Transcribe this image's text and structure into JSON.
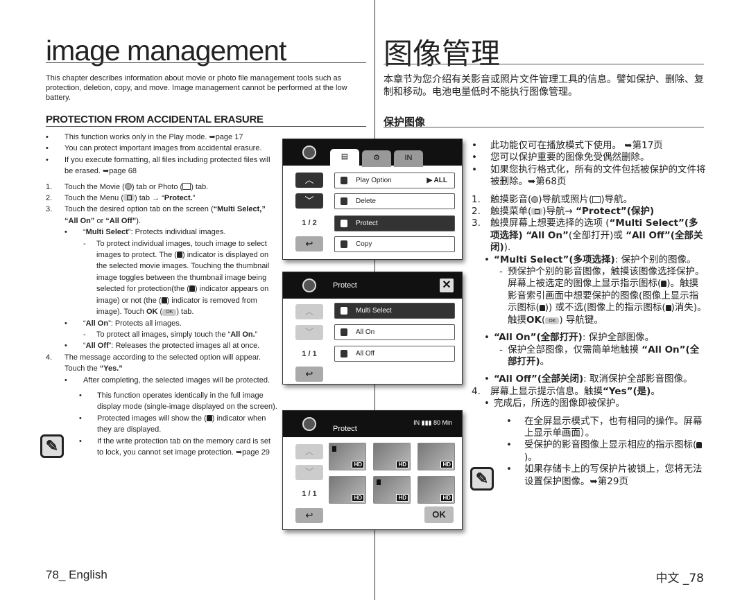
{
  "left": {
    "title": "image management",
    "intro": "This chapter describes information about movie or photo file management tools such as protection, deletion, copy, and move. Image management cannot be performed at the low battery.",
    "heading": "PROTECTION FROM ACCIDENTAL ERASURE",
    "items": [
      {
        "kind": "bullet",
        "mk": "•",
        "segs": [
          {
            "t": "This function works only in the Play mode. ➥page 17"
          }
        ]
      },
      {
        "kind": "bullet",
        "mk": "•",
        "segs": [
          {
            "t": "You can protect important images from accidental erasure."
          }
        ]
      },
      {
        "kind": "bullet",
        "mk": "•",
        "segs": [
          {
            "t": "If you execute formatting, all files including protected files will be erased. ➥page 68"
          }
        ]
      },
      {
        "kind": "num gap",
        "mk": "1.",
        "segs": [
          {
            "t": "Touch the Movie ("
          },
          {
            "icon": "movie"
          },
          {
            "t": ") tab or Photo ("
          },
          {
            "icon": "photo"
          },
          {
            "t": ") tab."
          }
        ]
      },
      {
        "kind": "num",
        "mk": "2.",
        "segs": [
          {
            "t": "Touch the Menu ("
          },
          {
            "icon": "menu"
          },
          {
            "t": ") tab → “"
          },
          {
            "t": "Protect.",
            "b": true
          },
          {
            "t": "”"
          }
        ]
      },
      {
        "kind": "num",
        "mk": "3.",
        "segs": [
          {
            "t": "Touch the desired option tab on the screen ("
          },
          {
            "t": "“Multi Select,” “All On”",
            "b": true
          },
          {
            "t": " or "
          },
          {
            "t": "“All Off”",
            "b": true
          },
          {
            "t": ")."
          }
        ]
      },
      {
        "kind": "sub",
        "mk": "•",
        "segs": [
          {
            "t": "“"
          },
          {
            "t": "Multi Select",
            "b": true
          },
          {
            "t": "”: Protects individual images."
          }
        ]
      },
      {
        "kind": "dash",
        "mk": "-",
        "segs": [
          {
            "t": "To protect individual images, touch image to select images to protect. The ("
          },
          {
            "icon": "lock"
          },
          {
            "t": ") indicator is displayed on the selected movie images. Touching the thumbnail image toggles between the thumbnail image being selected for protection(the ("
          },
          {
            "icon": "lock"
          },
          {
            "t": ") indicator appears on image) or not (the ("
          },
          {
            "icon": "lock"
          },
          {
            "t": ") indicator is removed from image). Touch "
          },
          {
            "t": "OK",
            "b": true
          },
          {
            "t": " ("
          },
          {
            "icon": "ok"
          },
          {
            "t": ") tab."
          }
        ]
      },
      {
        "kind": "sub",
        "mk": "•",
        "segs": [
          {
            "t": "“"
          },
          {
            "t": "All On",
            "b": true
          },
          {
            "t": "”: Protects all images."
          }
        ]
      },
      {
        "kind": "dash",
        "mk": "-",
        "segs": [
          {
            "t": "To protect all images, simply touch the “"
          },
          {
            "t": "All On.",
            "b": true
          },
          {
            "t": "”"
          }
        ]
      },
      {
        "kind": "sub",
        "mk": "•",
        "segs": [
          {
            "t": "“"
          },
          {
            "t": "All Off",
            "b": true
          },
          {
            "t": "”: Releases the protected images all at once."
          }
        ]
      },
      {
        "kind": "num",
        "mk": "4.",
        "segs": [
          {
            "t": "The message according to the selected option will appear. Touch the "
          },
          {
            "t": "“Yes.”",
            "b": true
          }
        ]
      },
      {
        "kind": "sub",
        "mk": "•",
        "segs": [
          {
            "t": "After completing, the selected images will be protected."
          }
        ]
      },
      {
        "kind": "note gap",
        "mk": "•",
        "segs": [
          {
            "t": "This function operates identically in the full image display mode (single-image displayed on the screen)."
          }
        ]
      },
      {
        "kind": "note",
        "mk": "•",
        "segs": [
          {
            "t": "Protected images will show the ("
          },
          {
            "icon": "lock"
          },
          {
            "t": ") indicator when they are displayed."
          }
        ]
      },
      {
        "kind": "note",
        "mk": "•",
        "segs": [
          {
            "t": "If the write protection tab on the memory card is set to lock, you cannot set image protection. ➥page 29"
          }
        ]
      }
    ],
    "footer": "78_ English"
  },
  "right": {
    "title": "图像管理",
    "intro": "本章节为您介绍有关影音或照片文件管理工具的信息。譬如保护、删除、复制和移动。电池电量低时不能执行图像管理。",
    "heading": "保护图像",
    "items": [
      {
        "kind": "bullet",
        "mk": "•",
        "segs": [
          {
            "t": "此功能仅可在播放模式下使用。 ➥第17页"
          }
        ]
      },
      {
        "kind": "bullet",
        "mk": "•",
        "segs": [
          {
            "t": "您可以保护重要的图像免受偶然删除。"
          }
        ]
      },
      {
        "kind": "bullet",
        "mk": "•",
        "segs": [
          {
            "t": "如果您执行格式化，所有的文件包括被保护的文件将被删除。➥第68页"
          }
        ]
      },
      {
        "kind": "num gap",
        "mk": "1.",
        "segs": [
          {
            "t": "触摸影音("
          },
          {
            "icon": "movie"
          },
          {
            "t": ")导航或照片("
          },
          {
            "icon": "photo"
          },
          {
            "t": ")导航。"
          }
        ]
      },
      {
        "kind": "num",
        "mk": "2.",
        "segs": [
          {
            "t": "触摸菜单("
          },
          {
            "icon": "menu"
          },
          {
            "t": ")导航→ "
          },
          {
            "t": "“Protect”(保护)",
            "b": true
          }
        ]
      },
      {
        "kind": "num",
        "mk": "3.",
        "segs": [
          {
            "t": "触摸屏幕上想要选择的选项 ("
          },
          {
            "t": "“Multi Select”(多项选择) “All On”",
            "b": true
          },
          {
            "t": "(全部打开)或 "
          },
          {
            "t": "“All Off”(全部关闭)",
            "b": true
          },
          {
            "t": ")."
          }
        ]
      },
      {
        "kind": "sub",
        "mk": "•",
        "segs": [
          {
            "t": "“Multi Select”(多项选择)",
            "b": true
          },
          {
            "t": ": 保护个别的图像。"
          }
        ]
      },
      {
        "kind": "dash",
        "mk": "-",
        "segs": [
          {
            "t": "预保护个别的影音图像，触摸该图像选择保护。屏幕上被选定的图像上显示指示图标("
          },
          {
            "icon": "lock"
          },
          {
            "t": ")。触摸影音索引画面中想要保护的图像(图像上显示指示图标("
          },
          {
            "icon": "lock"
          },
          {
            "t": ")) 或不选(图像上的指示图标("
          },
          {
            "icon": "lock"
          },
          {
            "t": ")消失)。 触摸"
          },
          {
            "t": "OK",
            "b": true
          },
          {
            "t": "("
          },
          {
            "icon": "ok"
          },
          {
            "t": ") 导航键。"
          }
        ]
      },
      {
        "kind": "sub gap",
        "mk": "•",
        "segs": [
          {
            "t": "“All On”(全部打开)",
            "b": true
          },
          {
            "t": ": 保护全部图像。"
          }
        ]
      },
      {
        "kind": "dash",
        "mk": "-",
        "segs": [
          {
            "t": "保护全部图像，仅需简单地触摸 "
          },
          {
            "t": "“All On”(全部打开)",
            "b": true
          },
          {
            "t": "。"
          }
        ]
      },
      {
        "kind": "sub gap",
        "mk": "•",
        "segs": [
          {
            "t": "“All Off”(全部关闭)",
            "b": true
          },
          {
            "t": ": 取消保护全部影音图像。"
          }
        ]
      },
      {
        "kind": "num",
        "mk": "4.",
        "segs": [
          {
            "t": "屏幕上显示提示信息。触摸"
          },
          {
            "t": "“Yes”(是)",
            "b": true
          },
          {
            "t": "。"
          }
        ]
      },
      {
        "kind": "sub",
        "mk": "•",
        "segs": [
          {
            "t": "完成后，所选的图像即被保护。"
          }
        ]
      },
      {
        "kind": "note gap",
        "mk": "•",
        "segs": [
          {
            "t": "在全屏显示模式下，也有相同的操作。屏幕上显示单画面）。"
          }
        ]
      },
      {
        "kind": "note",
        "mk": "•",
        "segs": [
          {
            "t": "受保护的影音图像上显示相应的指示图标("
          },
          {
            "icon": "lock"
          },
          {
            "t": ")。"
          }
        ]
      },
      {
        "kind": "note",
        "mk": "•",
        "segs": [
          {
            "t": "如果存储卡上的写保护片被锁上，您将无法设置保护图像。➥第29页"
          }
        ]
      }
    ],
    "footer": "中文 _78"
  },
  "screens": {
    "menu": {
      "tabs": [
        "▤",
        "⚙",
        "IN"
      ],
      "page": "1 / 2",
      "items": [
        {
          "label": "Play Option",
          "value": "▶ ALL"
        },
        {
          "label": "Delete"
        },
        {
          "label": "Protect",
          "selected": true
        },
        {
          "label": "Copy"
        }
      ]
    },
    "protect_menu": {
      "title": "Protect",
      "page": "1 / 1",
      "items": [
        {
          "label": "Multi Select",
          "selected": true
        },
        {
          "label": "All On"
        },
        {
          "label": "All Off"
        }
      ]
    },
    "protect_grid": {
      "title": "Protect",
      "status": "IN  ▮▮▮ 80 Min",
      "page": "1 / 1",
      "thumb_badge": "HD",
      "locked": [
        true,
        false,
        false,
        false,
        true,
        false
      ],
      "ok": "OK"
    }
  }
}
